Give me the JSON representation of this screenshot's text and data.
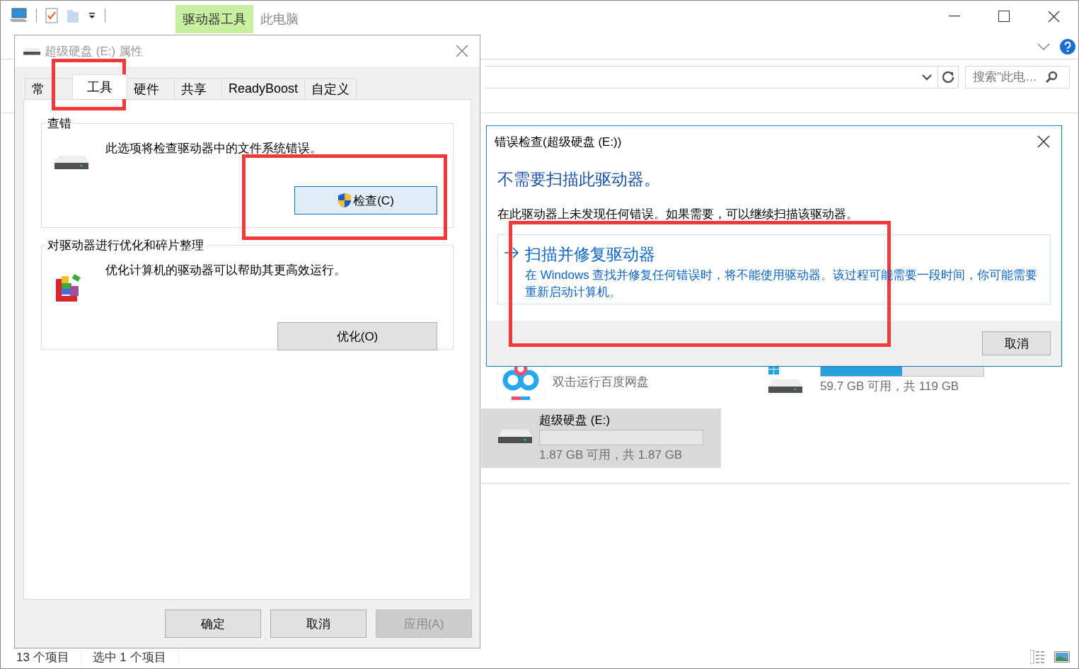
{
  "explorer": {
    "ribbon_tabs": [
      {
        "label": "驱动器工具",
        "kind": "contextual"
      },
      {
        "label": "此电脑",
        "kind": "normal"
      }
    ],
    "search": {
      "placeholder": "搜索\"此电…"
    },
    "items": [
      {
        "kind": "app",
        "subtitle": "双击运行百度网盘",
        "selected": false
      },
      {
        "kind": "drive",
        "system": true,
        "level": 0.5,
        "caption": "59.7 GB 可用，共 119 GB",
        "selected": false
      },
      {
        "kind": "drive",
        "system": false,
        "name": "超级硬盘 (E:)",
        "level": 0,
        "caption": "1.87 GB 可用，共 1.87 GB",
        "selected": true
      }
    ],
    "status": [
      "13 个项目",
      "选中 1 个项目"
    ]
  },
  "properties_dialog": {
    "title": "超级硬盘 (E:) 属性",
    "tabs": [
      {
        "label": "常",
        "selected": false
      },
      {
        "label": "工具",
        "selected": true
      },
      {
        "label": "硬件",
        "selected": false
      },
      {
        "label": "共享",
        "selected": false
      },
      {
        "label": "ReadyBoost",
        "selected": false
      },
      {
        "label": "自定义",
        "selected": false
      }
    ],
    "groups": [
      {
        "kind": "check",
        "title": "查错",
        "text": "此选项将检查驱动器中的文件系统错误。",
        "button": {
          "label": "检查(C)",
          "default": true
        }
      },
      {
        "kind": "optimize",
        "title": "对驱动器进行优化和碎片整理",
        "text": "优化计算机的驱动器可以帮助其更高效运行。",
        "button": {
          "label": "优化(O)",
          "default": false
        }
      }
    ],
    "buttons": [
      {
        "label": "确定",
        "disabled": false
      },
      {
        "label": "取消",
        "disabled": false
      },
      {
        "label": "应用(A)",
        "disabled": true
      }
    ]
  },
  "check_dialog": {
    "title": "错误检查(超级硬盘 (E:))",
    "heading": "不需要扫描此驱动器。",
    "message": "在此驱动器上未发现任何错误。如果需要，可以继续扫描该驱动器。",
    "option": {
      "title": "扫描并修复驱动器",
      "description": "在 Windows 查找并修复任何错误时，将不能使用驱动器。该过程可能需要一段时间，你可能需要重新启动计算机。"
    },
    "buttons": [
      "取消"
    ]
  },
  "annotations": [
    {
      "kind": "frame"
    },
    {
      "kind": "frame"
    },
    {
      "kind": "frame"
    }
  ]
}
